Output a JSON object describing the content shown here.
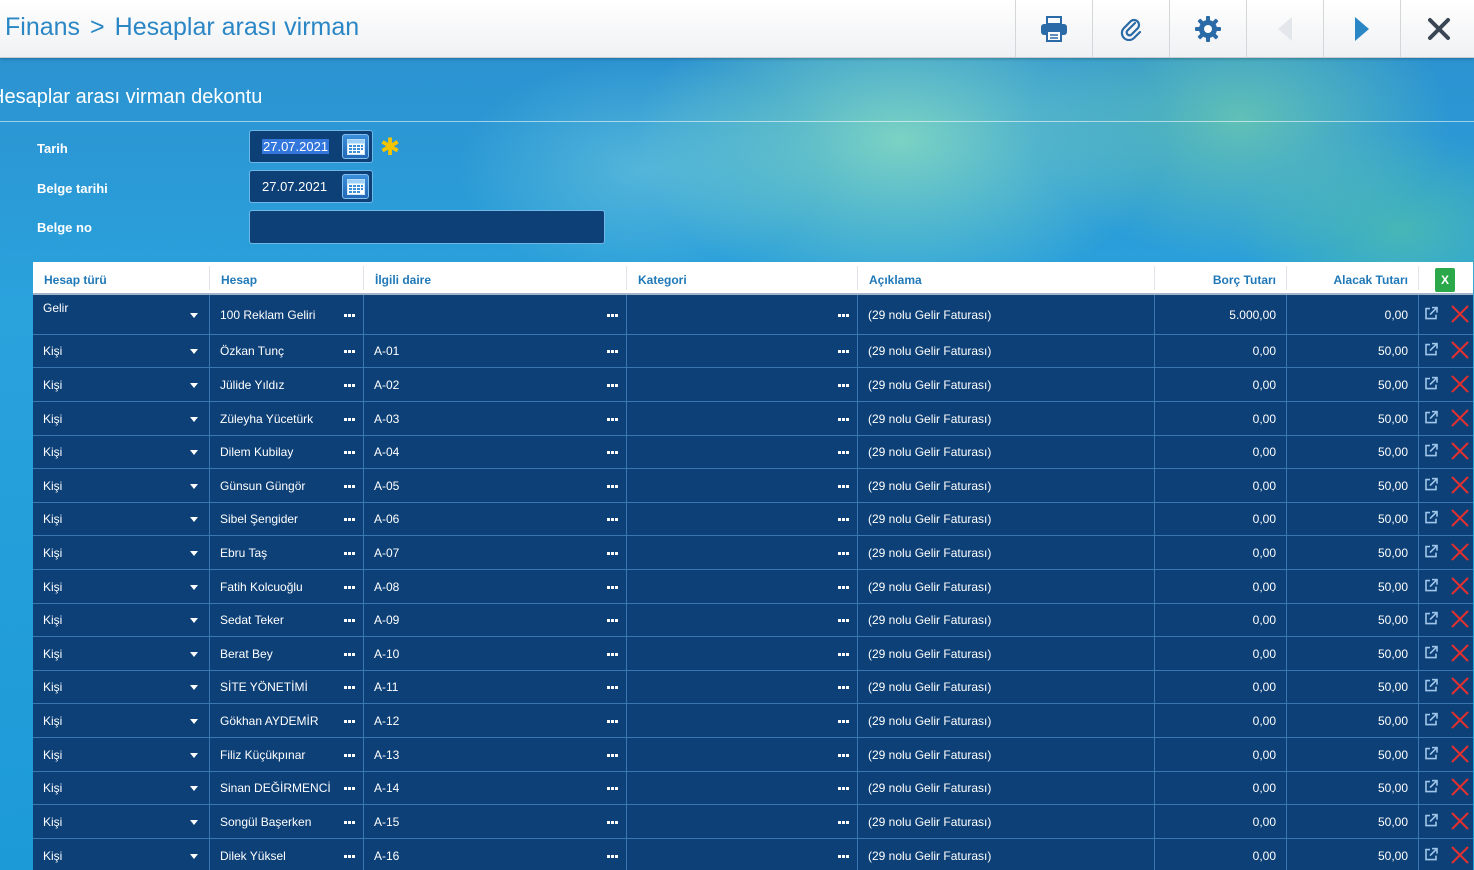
{
  "header": {
    "breadcrumb_root": "Finans",
    "breadcrumb_separator": ">",
    "breadcrumb_page": "Hesaplar arası virman",
    "buttons": [
      {
        "name": "print-button",
        "icon": "printer-icon"
      },
      {
        "name": "attach-button",
        "icon": "paperclip-icon"
      },
      {
        "name": "settings-button",
        "icon": "gear-icon"
      },
      {
        "name": "prev-button",
        "icon": "arrow-left-icon"
      },
      {
        "name": "next-button",
        "icon": "arrow-right-icon"
      },
      {
        "name": "close-button",
        "icon": "close-icon"
      }
    ]
  },
  "form": {
    "title": "Hesaplar arası virman dekontu",
    "tarih_label": "Tarih",
    "tarih_value": "27.07.2021",
    "belge_tarihi_label": "Belge tarihi",
    "belge_tarihi_value": "27.07.2021",
    "belge_no_label": "Belge no",
    "belge_no_value": "",
    "required_marker": "✱"
  },
  "grid": {
    "columns": [
      "Hesap türü",
      "Hesap",
      "İlgili daire",
      "Kategori",
      "Açıklama",
      "Borç Tutarı",
      "Alacak Tutarı"
    ],
    "excel_label": "X",
    "rows": [
      {
        "tur": "Gelir",
        "hesap": "100 Reklam Geliri",
        "daire": "",
        "kategori": "",
        "aciklama": "(29 nolu Gelir Faturası)",
        "borc": "5.000,00",
        "alacak": "0,00"
      },
      {
        "tur": "Kişi",
        "hesap": "Özkan Tunç",
        "daire": "A-01",
        "kategori": "",
        "aciklama": "(29 nolu Gelir Faturası)",
        "borc": "0,00",
        "alacak": "50,00"
      },
      {
        "tur": "Kişi",
        "hesap": "Jülide Yıldız",
        "daire": "A-02",
        "kategori": "",
        "aciklama": "(29 nolu Gelir Faturası)",
        "borc": "0,00",
        "alacak": "50,00"
      },
      {
        "tur": "Kişi",
        "hesap": "Züleyha Yücetürk",
        "daire": "A-03",
        "kategori": "",
        "aciklama": "(29 nolu Gelir Faturası)",
        "borc": "0,00",
        "alacak": "50,00"
      },
      {
        "tur": "Kişi",
        "hesap": "Dilem Kubilay",
        "daire": "A-04",
        "kategori": "",
        "aciklama": "(29 nolu Gelir Faturası)",
        "borc": "0,00",
        "alacak": "50,00"
      },
      {
        "tur": "Kişi",
        "hesap": "Günsun Güngör",
        "daire": "A-05",
        "kategori": "",
        "aciklama": "(29 nolu Gelir Faturası)",
        "borc": "0,00",
        "alacak": "50,00"
      },
      {
        "tur": "Kişi",
        "hesap": "Sibel Şengider",
        "daire": "A-06",
        "kategori": "",
        "aciklama": "(29 nolu Gelir Faturası)",
        "borc": "0,00",
        "alacak": "50,00"
      },
      {
        "tur": "Kişi",
        "hesap": "Ebru Taş",
        "daire": "A-07",
        "kategori": "",
        "aciklama": "(29 nolu Gelir Faturası)",
        "borc": "0,00",
        "alacak": "50,00"
      },
      {
        "tur": "Kişi",
        "hesap": "Fatih Kolcuoğlu",
        "daire": "A-08",
        "kategori": "",
        "aciklama": "(29 nolu Gelir Faturası)",
        "borc": "0,00",
        "alacak": "50,00"
      },
      {
        "tur": "Kişi",
        "hesap": "Sedat Teker",
        "daire": "A-09",
        "kategori": "",
        "aciklama": "(29 nolu Gelir Faturası)",
        "borc": "0,00",
        "alacak": "50,00"
      },
      {
        "tur": "Kişi",
        "hesap": "Berat Bey",
        "daire": "A-10",
        "kategori": "",
        "aciklama": "(29 nolu Gelir Faturası)",
        "borc": "0,00",
        "alacak": "50,00"
      },
      {
        "tur": "Kişi",
        "hesap": "SİTE YÖNETİMİ",
        "daire": "A-11",
        "kategori": "",
        "aciklama": "(29 nolu Gelir Faturası)",
        "borc": "0,00",
        "alacak": "50,00"
      },
      {
        "tur": "Kişi",
        "hesap": "Gökhan AYDEMİR",
        "daire": "A-12",
        "kategori": "",
        "aciklama": "(29 nolu Gelir Faturası)",
        "borc": "0,00",
        "alacak": "50,00"
      },
      {
        "tur": "Kişi",
        "hesap": "Filiz Küçükpınar",
        "daire": "A-13",
        "kategori": "",
        "aciklama": "(29 nolu Gelir Faturası)",
        "borc": "0,00",
        "alacak": "50,00"
      },
      {
        "tur": "Kişi",
        "hesap": "Sinan DEĞİRMENCİ",
        "daire": "A-14",
        "kategori": "",
        "aciklama": "(29 nolu Gelir Faturası)",
        "borc": "0,00",
        "alacak": "50,00"
      },
      {
        "tur": "Kişi",
        "hesap": "Songül Başerken",
        "daire": "A-15",
        "kategori": "",
        "aciklama": "(29 nolu Gelir Faturası)",
        "borc": "0,00",
        "alacak": "50,00"
      },
      {
        "tur": "Kişi",
        "hesap": "Dilek Yüksel",
        "daire": "A-16",
        "kategori": "",
        "aciklama": "(29 nolu Gelir Faturası)",
        "borc": "0,00",
        "alacak": "50,00"
      }
    ]
  },
  "colors": {
    "accent": "#2a86c4",
    "row_bg": "#0d4077",
    "delete": "#e03030",
    "excel": "#2aa84a"
  }
}
